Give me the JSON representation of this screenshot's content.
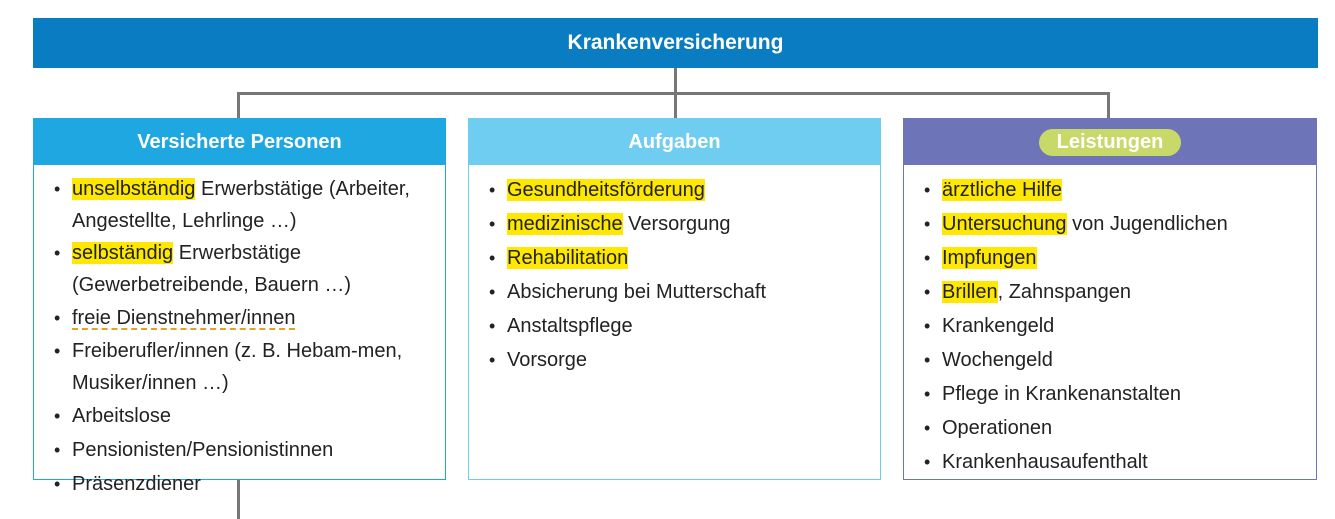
{
  "title": "Krankenversicherung",
  "colors": {
    "title_bar": "#0a7cc1",
    "box1": "#1ea7e1",
    "box2": "#6fcdf1",
    "box3": "#6e74b8",
    "highlight": "#ffe800"
  },
  "boxes": [
    {
      "heading": "Versicherte Personen",
      "items": [
        {
          "parts": [
            "unselbständig",
            " Erwerbstätige (Arbeiter, Angestellte, Lehrlinge …)"
          ]
        },
        {
          "parts": [
            "selbständig",
            " Erwerbstätige (Gewerbetreibende, Bauern …)"
          ]
        },
        {
          "text": "freie Dienstnehmer/innen"
        },
        {
          "text": "Freiberufler/innen (z. B. Hebam-men, Musiker/innen …)"
        },
        {
          "text": "Arbeitslose"
        },
        {
          "text": "Pensionisten/Pensionistinnen"
        },
        {
          "text": "Präsenzdiener"
        }
      ]
    },
    {
      "heading": "Aufgaben",
      "items": [
        {
          "text": "Gesundheitsförderung"
        },
        {
          "parts": [
            "medizinische",
            " Versorgung"
          ]
        },
        {
          "text": "Rehabilitation"
        },
        {
          "text": "Absicherung bei Mutterschaft"
        },
        {
          "text": "Anstaltspflege"
        },
        {
          "text": "Vorsorge"
        }
      ]
    },
    {
      "heading": "Leistungen",
      "items": [
        {
          "text": "ärztliche Hilfe"
        },
        {
          "parts": [
            "Untersuchung",
            " von Jugendlichen"
          ]
        },
        {
          "parts": [
            "Impfungen",
            ""
          ]
        },
        {
          "parts": [
            "Brillen",
            ", Zahnspangen"
          ]
        },
        {
          "text": "Krankengeld"
        },
        {
          "text": "Wochengeld"
        },
        {
          "text": "Pflege in Krankenanstalten"
        },
        {
          "text": "Operationen"
        },
        {
          "text": "Krankenhausaufenthalt"
        }
      ]
    }
  ]
}
